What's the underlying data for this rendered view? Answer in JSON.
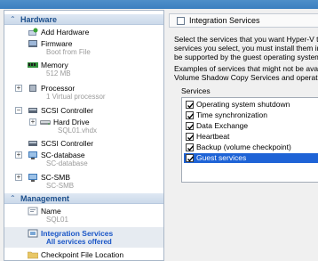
{
  "hardware_section": {
    "title": "Hardware"
  },
  "management_section": {
    "title": "Management"
  },
  "hardware_items": [
    {
      "label": "Add Hardware",
      "icon": "add-hardware-icon"
    },
    {
      "label": "Firmware",
      "sub": "Boot from File",
      "icon": "firmware-icon"
    },
    {
      "label": "Memory",
      "sub": "512 MB",
      "icon": "memory-icon"
    },
    {
      "label": "Processor",
      "sub": "1 Virtual processor",
      "icon": "processor-icon",
      "expander": "+"
    },
    {
      "label": "SCSI Controller",
      "icon": "scsi-controller-icon",
      "expander": "−"
    },
    {
      "label": "Hard Drive",
      "sub": "SQL01.vhdx",
      "icon": "hard-drive-icon",
      "expander": "+"
    },
    {
      "label": "SCSI Controller",
      "icon": "scsi-controller-icon"
    },
    {
      "label": "SC-database",
      "sub": "SC-database",
      "icon": "network-adapter-icon",
      "expander": "+"
    },
    {
      "label": "SC-SMB",
      "sub": "SC-SMB",
      "icon": "network-adapter-icon",
      "expander": "+"
    }
  ],
  "management_items": [
    {
      "label": "Name",
      "sub": "SQL01",
      "icon": "name-icon"
    },
    {
      "label": "Integration Services",
      "sub": "All services offered",
      "icon": "integration-services-icon"
    },
    {
      "label": "Checkpoint File Location",
      "icon": "checkpoint-folder-icon"
    }
  ],
  "right_panel": {
    "header_title": "Integration Services",
    "desc_lines": [
      "Select the services that you want Hyper-V to",
      "services you select, you must install them in t",
      "be supported by the guest operating system"
    ],
    "example_lines": [
      "Examples of services that might not be availa",
      "Volume Shadow Copy Services and operating"
    ],
    "services_label": "Services",
    "services": [
      {
        "label": "Operating system shutdown",
        "checked": true
      },
      {
        "label": "Time synchronization",
        "checked": true
      },
      {
        "label": "Data Exchange",
        "checked": true
      },
      {
        "label": "Heartbeat",
        "checked": true
      },
      {
        "label": "Backup (volume checkpoint)",
        "checked": true
      },
      {
        "label": "Guest services",
        "checked": true,
        "selected": true
      }
    ]
  },
  "colors": {
    "accent_blue": "#1e63d6",
    "selection_text": "#1a56c7",
    "section_title": "#1c4f8c"
  }
}
